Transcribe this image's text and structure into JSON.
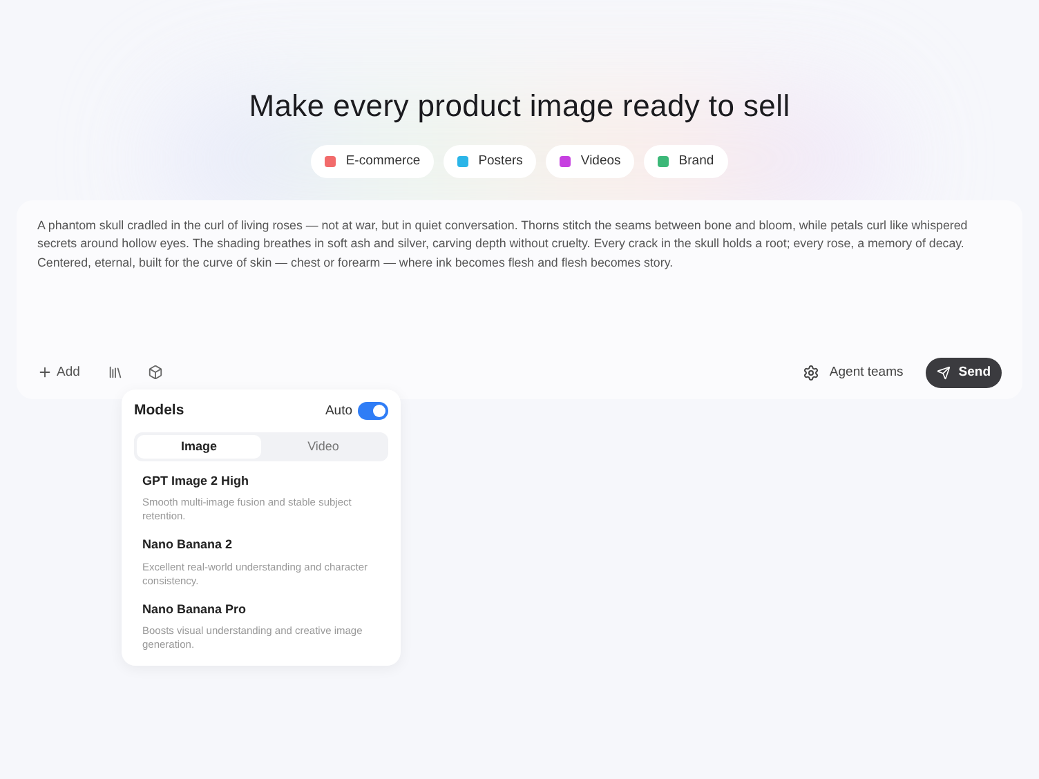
{
  "headline": "Make every product image ready to sell",
  "categories": [
    {
      "label": "E-commerce",
      "color": "#f26b6b"
    },
    {
      "label": "Posters",
      "color": "#2bb5e8"
    },
    {
      "label": "Videos",
      "color": "#c640e0"
    },
    {
      "label": "Brand",
      "color": "#3cb878"
    }
  ],
  "prompt": {
    "value": "A phantom skull cradled in the curl of living roses — not at war, but in quiet conversation. Thorns stitch the seams between bone and bloom, while petals curl like whispered secrets around hollow eyes. The shading breathes in soft ash and silver, carving depth without cruelty. Every crack in the skull holds a root; every rose, a memory of decay. Centered, eternal, built for the curve of skin — chest or forearm — where ink becomes flesh and flesh becomes story."
  },
  "toolbar": {
    "add": "Add",
    "agent_teams": "Agent teams",
    "send": "Send"
  },
  "models_panel": {
    "title": "Models",
    "auto_label": "Auto",
    "auto_on": true,
    "tabs": [
      {
        "label": "Image",
        "selected": true
      },
      {
        "label": "Video",
        "selected": false
      }
    ],
    "models": [
      {
        "name": "GPT Image 2 High",
        "description": "Smooth multi-image fusion and stable subject retention."
      },
      {
        "name": "Nano Banana 2",
        "description": "Excellent real-world understanding and character consistency."
      },
      {
        "name": "Nano Banana Pro",
        "description": "Boosts visual understanding and creative image generation."
      }
    ]
  }
}
